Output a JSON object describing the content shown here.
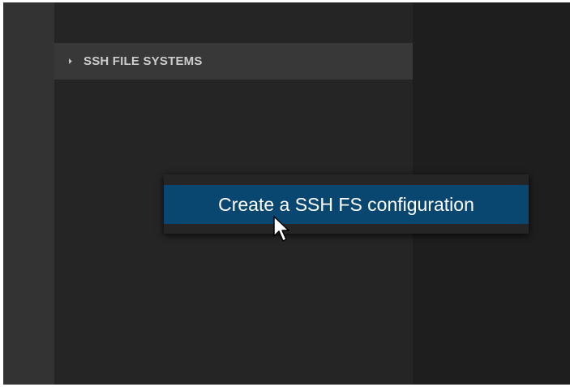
{
  "sidebar": {
    "section": {
      "title": "SSH FILE SYSTEMS",
      "expanded": true
    }
  },
  "context_menu": {
    "items": [
      {
        "label": "Create a SSH FS configuration",
        "highlighted": true
      }
    ]
  },
  "colors": {
    "activity_bar": "#333333",
    "sidebar": "#252526",
    "section_header": "#383838",
    "editor": "#1e1e1e",
    "menu_highlight": "#094771"
  }
}
